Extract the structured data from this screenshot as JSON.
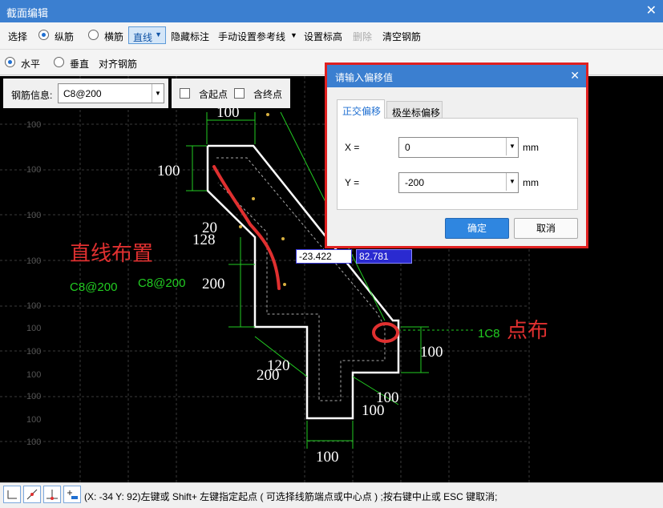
{
  "window": {
    "title": "截面编辑",
    "close": "✕"
  },
  "toolbar1": {
    "select": "选择",
    "longitudinal": "纵筋",
    "transverse": "横筋",
    "line": "直线",
    "hide_annotation": "隐藏标注",
    "manual_ref_line": "手动设置参考线",
    "set_elevation": "设置标高",
    "delete": "删除",
    "clear_rebar": "清空钢筋"
  },
  "toolbar2": {
    "horizontal": "水平",
    "vertical": "垂直",
    "align_rebar": "对齐钢筋"
  },
  "rebar_info": {
    "label": "钢筋信息:",
    "value": "C8@200",
    "start_point": "含起点",
    "end_point": "含终点"
  },
  "dialog": {
    "title": "请输入偏移值",
    "tab_ortho": "正交偏移",
    "tab_polar": "极坐标偏移",
    "x_label": "X =",
    "x_value": "0",
    "y_label": "Y =",
    "y_value": "-200",
    "unit": "mm",
    "ok": "确定",
    "cancel": "取消"
  },
  "canvas": {
    "grid_labels": [
      "100",
      "100",
      "100",
      "100",
      "100",
      "100",
      "100",
      "100",
      "100",
      "100",
      "100"
    ],
    "dims": {
      "d100_top": "100",
      "d100_left": "100",
      "d20": "20",
      "d128": "128",
      "d200_mid": "200",
      "d100_right": "100",
      "d120": "120",
      "d200_bottom": "200",
      "d100_b1": "100",
      "d100_b2": "100",
      "d100_bottom": "100"
    },
    "label_c8_left": "C8@200",
    "label_c8_mid": "C8@200",
    "label_1c8": "1C8",
    "annotation_line": "直线布置",
    "annotation_point": "点布",
    "coord_x": "-23.422",
    "coord_y": "82.781"
  },
  "status": {
    "text": "(X: -34 Y: 92)左键或 Shift+ 左键指定起点 ( 可选择线筋端点或中心点 ) ;按右键中止或 ESC 键取消;"
  },
  "colors": {
    "accent": "#3b7fd0",
    "dim_green": "#22cc22",
    "annotation_red": "#e03030",
    "canvas_bg": "#000000"
  }
}
